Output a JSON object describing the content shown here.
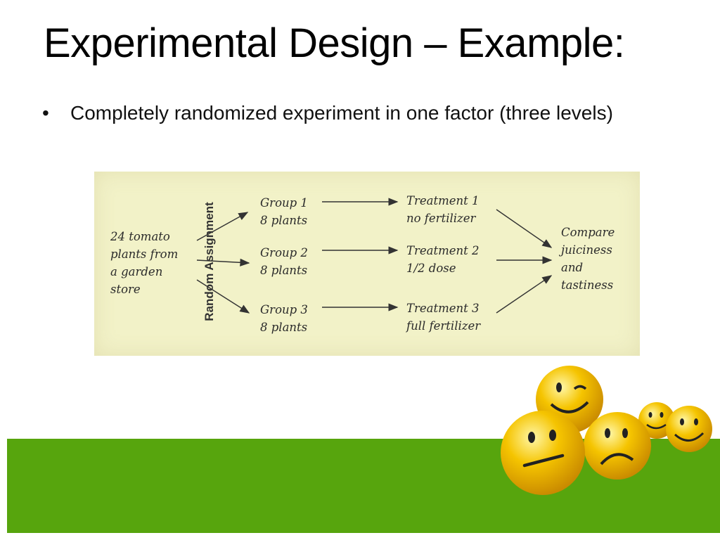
{
  "slide": {
    "title": "Experimental Design – Example:",
    "bullet": "Completely randomized experiment in one factor (three levels)"
  },
  "diagram": {
    "source": "24 tomato\nplants from\na garden\nstore",
    "assignment_label": "Random Assignment",
    "groups": [
      {
        "label": "Group 1\n8 plants",
        "treatment": "Treatment 1\nno fertilizer"
      },
      {
        "label": "Group 2\n8 plants",
        "treatment": "Treatment 2\n1/2 dose"
      },
      {
        "label": "Group 3\n8 plants",
        "treatment": "Treatment 3\nfull fertilizer"
      }
    ],
    "outcome": "Compare\njuiciness\nand\ntastiness"
  },
  "colors": {
    "panel": "#f2f2c8",
    "band": "#57a50d",
    "smiley": "#f5c400"
  },
  "decoration": {
    "icons": [
      "winking-smiley-icon",
      "neutral-smiley-icon",
      "sad-smiley-icon",
      "smiley-icon",
      "grinning-smiley-icon"
    ]
  }
}
